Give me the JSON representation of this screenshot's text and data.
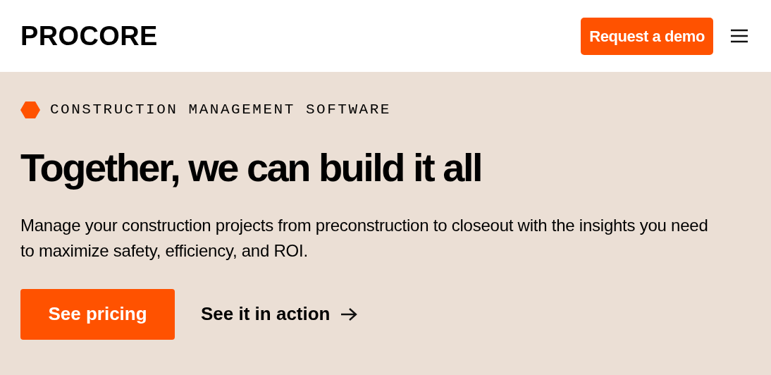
{
  "header": {
    "logo": "PROCORE",
    "demo_button": "Request a demo"
  },
  "hero": {
    "eyebrow": "CONSTRUCTION MANAGEMENT SOFTWARE",
    "title": "Together, we can build it all",
    "description": "Manage your construction projects from preconstruction to closeout with the insights you need to maximize safety, efficiency, and ROI.",
    "primary_button": "See pricing",
    "secondary_link": "See it in action"
  }
}
